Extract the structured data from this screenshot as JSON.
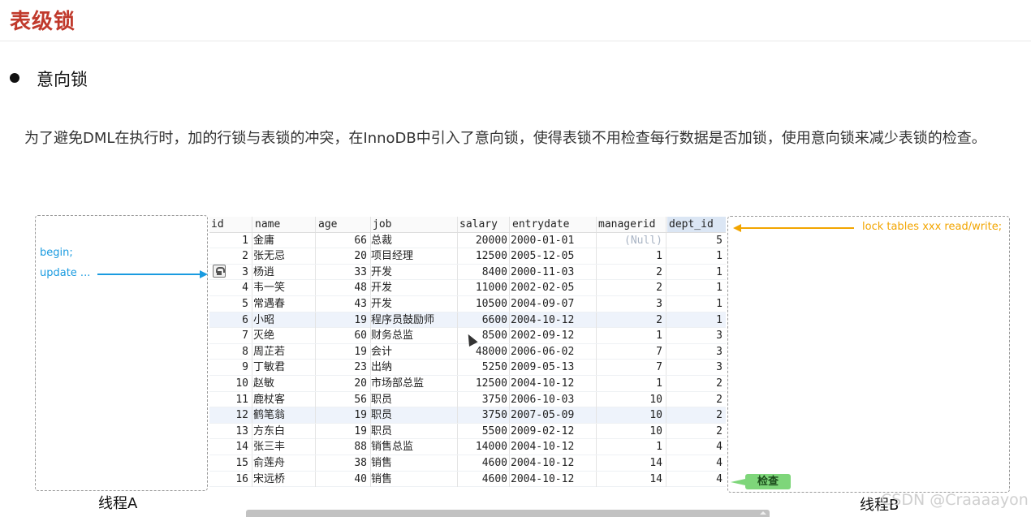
{
  "slide": {
    "title": "表级锁",
    "bullet": "意向锁",
    "paragraph": "为了避免DML在执行时，加的行锁与表锁的冲突，在InnoDB中引入了意向锁，使得表锁不用检查每行数据是否加锁，使用意向锁来减少表锁的检查。"
  },
  "threadA": {
    "begin": "begin;",
    "update": "update ...",
    "label": "线程A"
  },
  "threadB": {
    "statement": "lock tables xxx read/write;",
    "check": "检查",
    "label": "线程B"
  },
  "table": {
    "columns": [
      "id",
      "name",
      "age",
      "job",
      "salary",
      "entrydate",
      "managerid",
      "dept_id"
    ],
    "rows": [
      [
        "1",
        "金庸",
        "66",
        "总裁",
        "20000",
        "2000-01-01",
        "(Null)",
        "5"
      ],
      [
        "2",
        "张无忌",
        "20",
        "项目经理",
        "12500",
        "2005-12-05",
        "1",
        "1"
      ],
      [
        "3",
        "杨逍",
        "33",
        "开发",
        "8400",
        "2000-11-03",
        "2",
        "1"
      ],
      [
        "4",
        "韦一笑",
        "48",
        "开发",
        "11000",
        "2002-02-05",
        "2",
        "1"
      ],
      [
        "5",
        "常遇春",
        "43",
        "开发",
        "10500",
        "2004-09-07",
        "3",
        "1"
      ],
      [
        "6",
        "小昭",
        "19",
        "程序员鼓励师",
        "6600",
        "2004-10-12",
        "2",
        "1"
      ],
      [
        "7",
        "灭绝",
        "60",
        "财务总监",
        "8500",
        "2002-09-12",
        "1",
        "3"
      ],
      [
        "8",
        "周芷若",
        "19",
        "会计",
        "48000",
        "2006-06-02",
        "7",
        "3"
      ],
      [
        "9",
        "丁敏君",
        "23",
        "出纳",
        "5250",
        "2009-05-13",
        "7",
        "3"
      ],
      [
        "10",
        "赵敏",
        "20",
        "市场部总监",
        "12500",
        "2004-10-12",
        "1",
        "2"
      ],
      [
        "11",
        "鹿杖客",
        "56",
        "职员",
        "3750",
        "2006-10-03",
        "10",
        "2"
      ],
      [
        "12",
        "鹤笔翁",
        "19",
        "职员",
        "3750",
        "2007-05-09",
        "10",
        "2"
      ],
      [
        "13",
        "方东白",
        "19",
        "职员",
        "5500",
        "2009-02-12",
        "10",
        "2"
      ],
      [
        "14",
        "张三丰",
        "88",
        "销售总监",
        "14000",
        "2004-10-12",
        "1",
        "4"
      ],
      [
        "15",
        "俞莲舟",
        "38",
        "销售",
        "4600",
        "2004-10-12",
        "14",
        "4"
      ],
      [
        "16",
        "宋远桥",
        "40",
        "销售",
        "4600",
        "2004-10-12",
        "14",
        "4"
      ]
    ]
  },
  "watermark": "CSDN @Craaaayon",
  "colors": {
    "title": "#c0392b",
    "threadA_arrow": "#1a9be0",
    "threadB_arrow": "#f2a500",
    "check_badge": "#7ed67a"
  }
}
